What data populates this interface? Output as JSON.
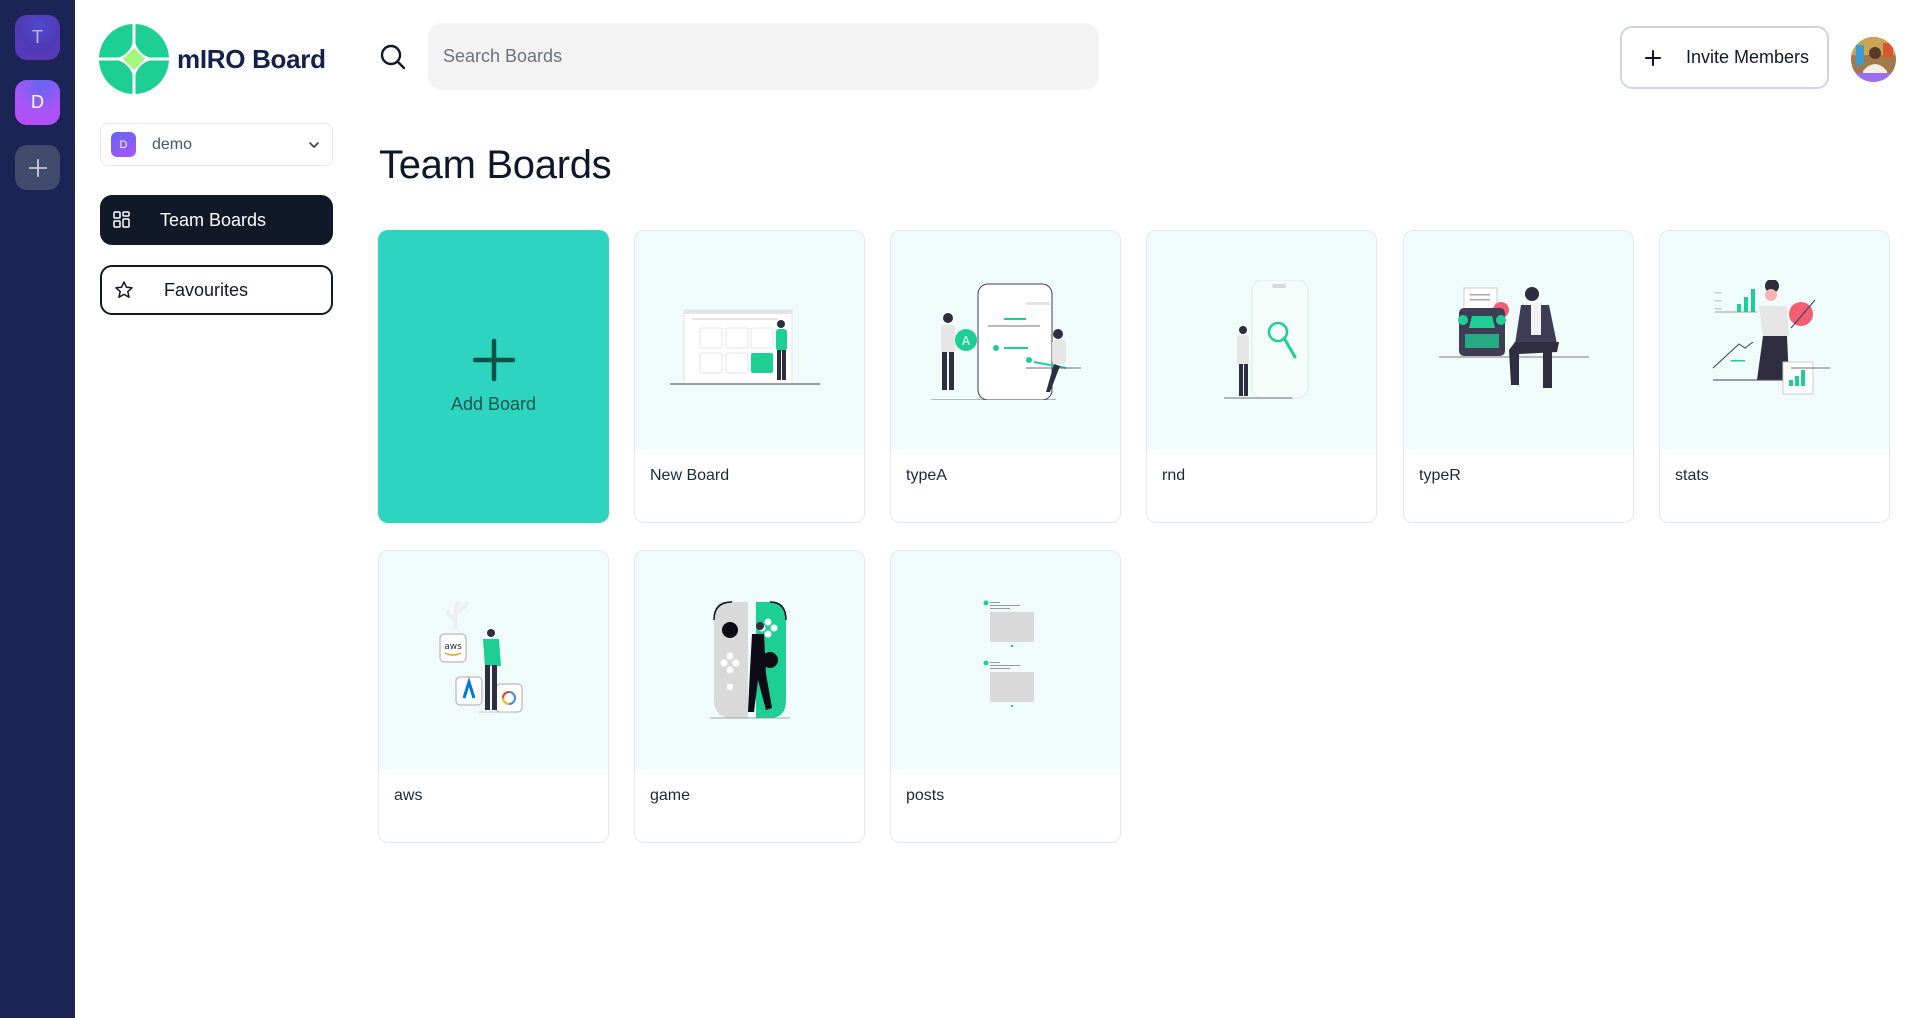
{
  "rail": {
    "orgs": [
      {
        "initial": "T",
        "name": "T"
      },
      {
        "initial": "D",
        "name": "D"
      }
    ],
    "add_icon": "plus-icon"
  },
  "sidebar": {
    "logo_text": "mIRO Board",
    "org_select": {
      "initial": "D",
      "value": "demo"
    },
    "nav": [
      {
        "label": "Team Boards",
        "icon": "grid-icon",
        "active": true
      },
      {
        "label": "Favourites",
        "icon": "star-icon",
        "active": false
      }
    ]
  },
  "header": {
    "search_placeholder": "Search Boards",
    "search_value": "",
    "invite_label": "Invite Members"
  },
  "main": {
    "title": "Team Boards",
    "add_board_label": "Add Board",
    "boards": [
      {
        "title": "New Board",
        "illustration": "board-woman"
      },
      {
        "title": "typeA",
        "illustration": "chat-phone"
      },
      {
        "title": "rnd",
        "illustration": "search-phone"
      },
      {
        "title": "typeR",
        "illustration": "typewriter"
      },
      {
        "title": "stats",
        "illustration": "stats-woman"
      },
      {
        "title": "aws",
        "illustration": "cloud-providers"
      },
      {
        "title": "game",
        "illustration": "game-controller"
      },
      {
        "title": "posts",
        "illustration": "posts-list"
      }
    ]
  },
  "colors": {
    "rail_bg": "#1b2555",
    "accent": "#2dd4bf",
    "illustration_green": "#1ecf94",
    "card_art_bg": "#effcfa",
    "nav_active_bg": "#111827"
  }
}
